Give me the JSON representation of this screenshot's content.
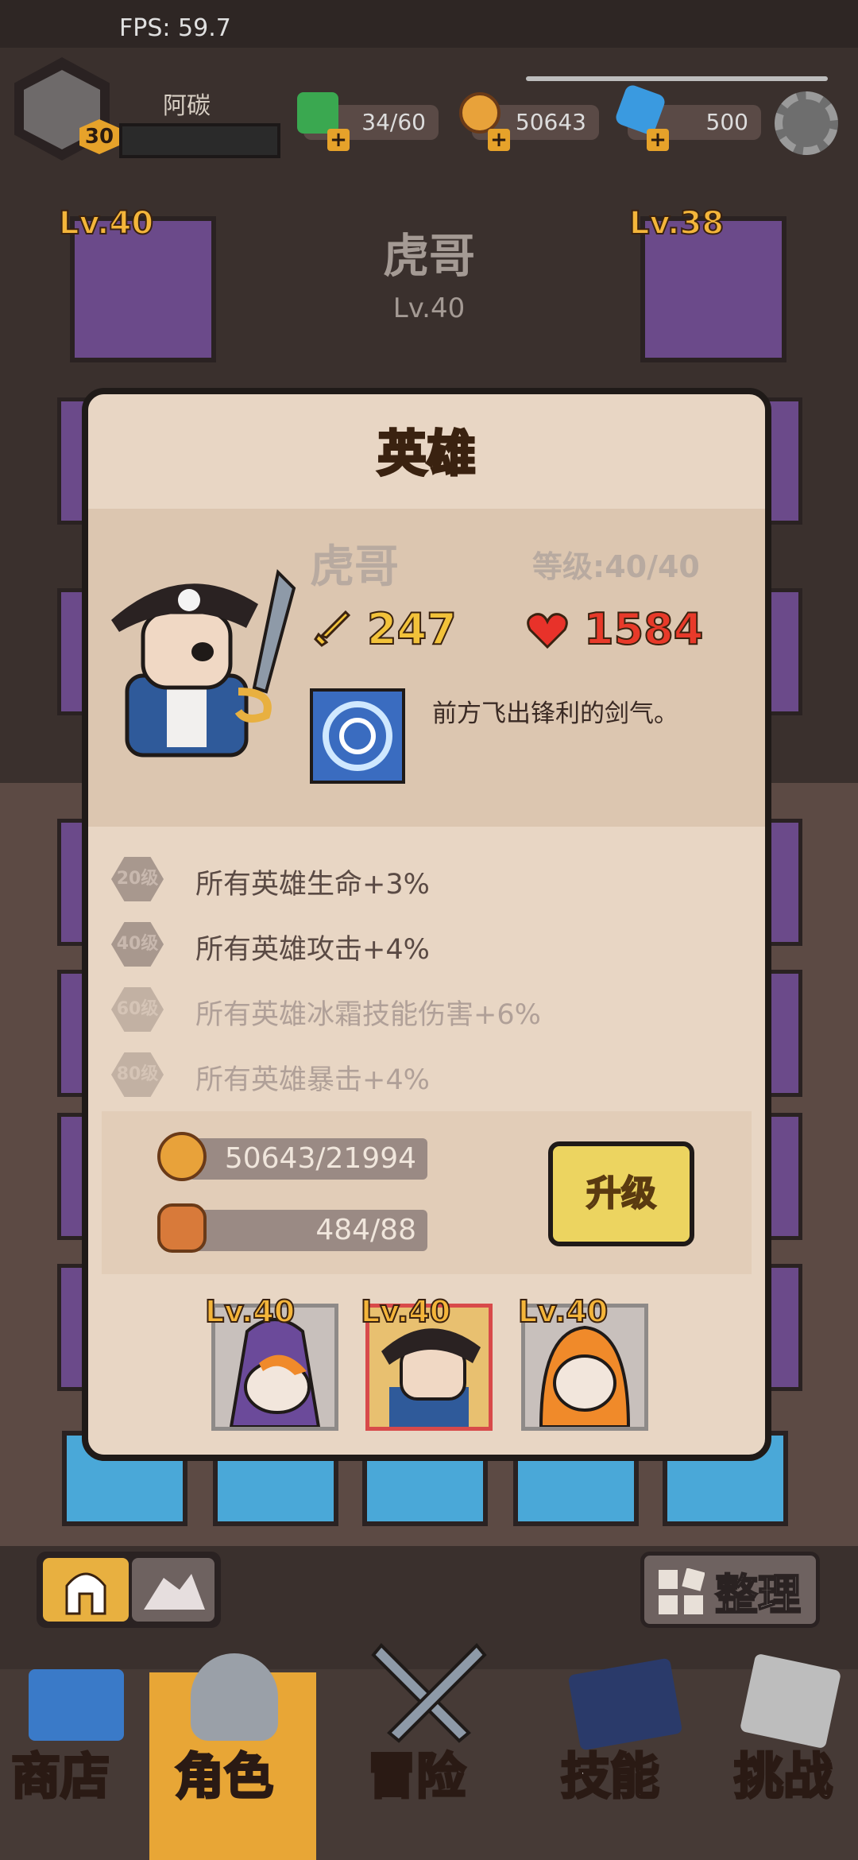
{
  "status": {
    "fps": "FPS: 59.7"
  },
  "player": {
    "name": "阿碳",
    "level": "30"
  },
  "resources": {
    "energy": "34/60",
    "gold": "50643",
    "gems": "500"
  },
  "showcase": {
    "hero_name": "虎哥",
    "hero_level": "Lv.40",
    "left_equip_level": "Lv.40",
    "right_equip_level": "Lv.38"
  },
  "dialog": {
    "title": "英雄",
    "hero_name": "虎哥",
    "level": "等级:40/40",
    "attack": "247",
    "hp": "1584",
    "skill_description": "前方飞出锋利的剑气。",
    "bonuses": [
      {
        "badge": "20级",
        "text": "所有英雄生命+3%",
        "unlocked": true
      },
      {
        "badge": "40级",
        "text": "所有英雄攻击+4%",
        "unlocked": true
      },
      {
        "badge": "60级",
        "text": "所有英雄冰霜技能伤害+6%",
        "unlocked": false
      },
      {
        "badge": "80级",
        "text": "所有英雄暴击+4%",
        "unlocked": false
      }
    ],
    "cost_gold": "50643/21994",
    "cost_token": "484/88",
    "upgrade_label": "升级",
    "team": [
      {
        "level": "Lv.40",
        "selected": false
      },
      {
        "level": "Lv.40",
        "selected": true
      },
      {
        "level": "Lv.40",
        "selected": false
      }
    ]
  },
  "bottom": {
    "sort_label": "整理"
  },
  "nav": [
    {
      "label": "商店"
    },
    {
      "label": "角色",
      "active": true
    },
    {
      "label": "冒险"
    },
    {
      "label": "技能"
    },
    {
      "label": "挑战"
    }
  ],
  "colors": {
    "accent": "#e8a636",
    "purple_card": "#6b4a8a",
    "dialog_bg": "#e8d6c4"
  }
}
